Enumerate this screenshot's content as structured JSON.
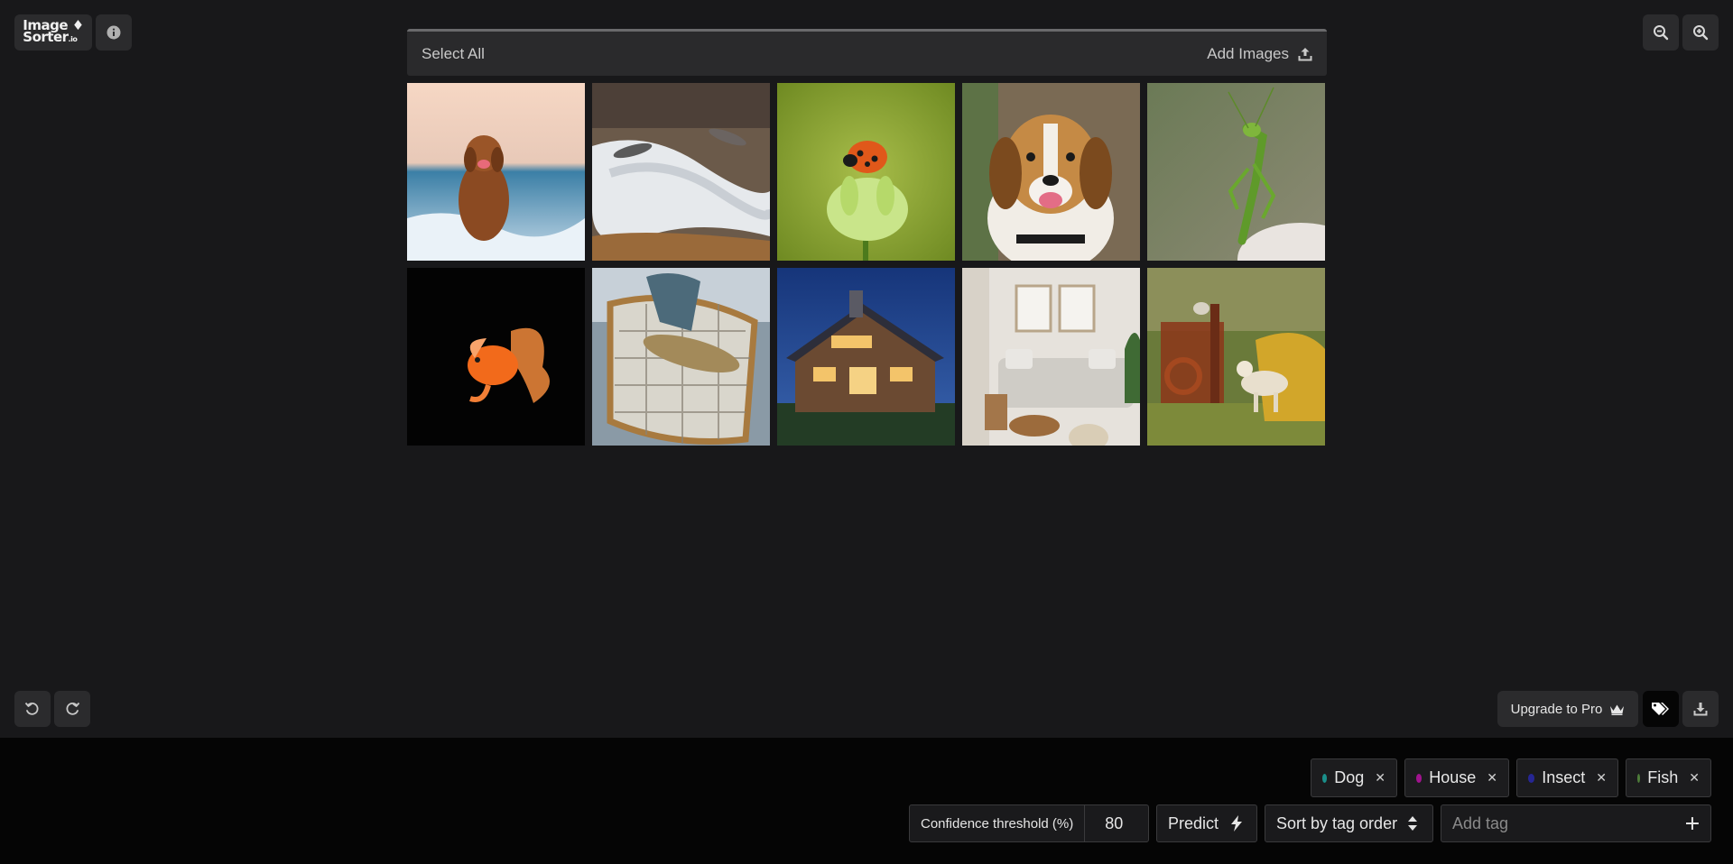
{
  "app": {
    "logo_line1": "Image",
    "logo_line2": "Sorter",
    "logo_tld": ".io"
  },
  "toolbar": {
    "select_all_label": "Select All",
    "add_images_label": "Add Images"
  },
  "images": [
    {
      "name": "dog-on-beach"
    },
    {
      "name": "salmon-in-river"
    },
    {
      "name": "ladybug-on-flower"
    },
    {
      "name": "beagle-portrait"
    },
    {
      "name": "praying-mantis"
    },
    {
      "name": "goldfish"
    },
    {
      "name": "trout-in-net"
    },
    {
      "name": "house-at-night"
    },
    {
      "name": "living-room"
    },
    {
      "name": "dog-and-cat-in-garden"
    }
  ],
  "actions": {
    "upgrade_label": "Upgrade to Pro"
  },
  "tags": [
    {
      "label": "Dog",
      "color": "#1a8f8a"
    },
    {
      "label": "House",
      "color": "#a0138e"
    },
    {
      "label": "Insect",
      "color": "#262694"
    },
    {
      "label": "Fish",
      "color": "#4e7d3a"
    }
  ],
  "controls": {
    "confidence_label": "Confidence threshold (%)",
    "confidence_value": "80",
    "predict_label": "Predict",
    "sort_label": "Sort by tag order",
    "add_tag_placeholder": "Add tag"
  }
}
